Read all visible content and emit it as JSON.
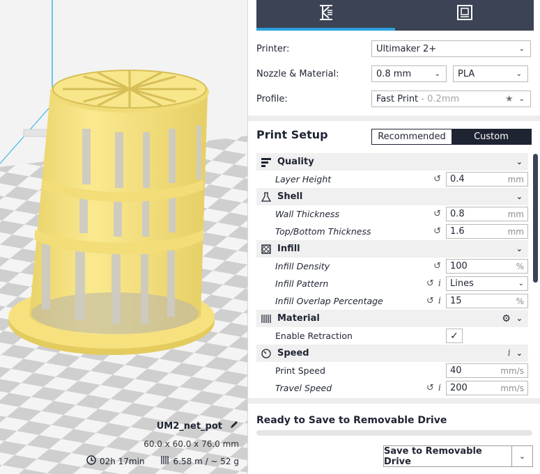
{
  "viewport": {
    "model_name": "UM2_net_pot",
    "dimensions": "60.0 x 60.0 x 76.0 mm",
    "print_time": "02h 17min",
    "material_usage": "6.58 m / ~ 52 g",
    "icons": [
      "edit-icon",
      "clock-icon",
      "filament-icon"
    ]
  },
  "tabs": [
    {
      "icon": "prepare-icon",
      "active": true
    },
    {
      "icon": "monitor-icon",
      "active": false
    }
  ],
  "printer": {
    "label": "Printer:",
    "value": "Ultimaker 2+"
  },
  "nozzle_material": {
    "label": "Nozzle & Material:",
    "nozzle": "0.8 mm",
    "material": "PLA"
  },
  "profile": {
    "label": "Profile:",
    "value": "Fast Print",
    "detail": " - 0.2mm"
  },
  "print_setup": {
    "title": "Print Setup",
    "modes": [
      "Recommended",
      "Custom"
    ],
    "active_mode": "Custom"
  },
  "categories": {
    "quality": {
      "label": "Quality"
    },
    "shell": {
      "label": "Shell"
    },
    "infill": {
      "label": "Infill"
    },
    "material": {
      "label": "Material"
    },
    "speed": {
      "label": "Speed"
    }
  },
  "settings": {
    "layer_height": {
      "label": "Layer Height",
      "value": "0.4",
      "unit": "mm"
    },
    "wall_thickness": {
      "label": "Wall Thickness",
      "value": "0.8",
      "unit": "mm"
    },
    "top_bottom_thickness": {
      "label": "Top/Bottom Thickness",
      "value": "1.6",
      "unit": "mm"
    },
    "infill_density": {
      "label": "Infill Density",
      "value": "100",
      "unit": "%"
    },
    "infill_pattern": {
      "label": "Infill Pattern",
      "value": "Lines"
    },
    "infill_overlap": {
      "label": "Infill Overlap Percentage",
      "value": "15",
      "unit": "%"
    },
    "enable_retraction": {
      "label": "Enable Retraction",
      "checked": true
    },
    "print_speed": {
      "label": "Print Speed",
      "value": "40",
      "unit": "mm/s"
    },
    "travel_speed": {
      "label": "Travel Speed",
      "value": "200",
      "unit": "mm/s"
    }
  },
  "status": {
    "text": "Ready to Save to Removable Drive",
    "progress": 0
  },
  "save_button": {
    "label": "Save to Removable Drive"
  },
  "colors": {
    "accent": "#2ba1dc",
    "dark": "#1f2433",
    "tab_bg": "#3c4355",
    "model": "#f8e78a"
  }
}
